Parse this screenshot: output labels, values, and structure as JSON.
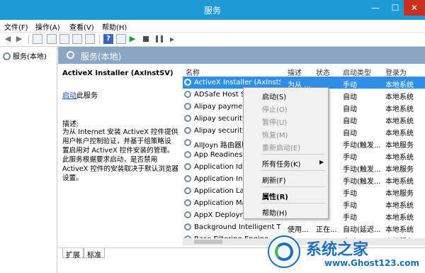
{
  "window": {
    "title": "服务",
    "min": "—",
    "max": "☐",
    "close": "✕"
  },
  "menu": [
    "文件(F)",
    "操作(A)",
    "查看(V)",
    "帮助(H)"
  ],
  "tree": {
    "root": "服务(本地)"
  },
  "pane": {
    "title": "服务(本地)"
  },
  "details": {
    "service_name": "ActiveX Installer (AxInstSV)",
    "start_link": "启动",
    "start_suffix": "此服务",
    "desc_label": "描述:",
    "desc_lines": [
      "为从 Internet 安装 ActiveX 控件提供",
      "用户帐户控制验证，并基于组策略设",
      "置启用对 ActiveX 控件安装的管理。",
      "此服务根据要求启动，是否禁用",
      "ActiveX 控件的安装取决于默认浏览器",
      "设置。"
    ]
  },
  "list": {
    "headers": {
      "name": "名称",
      "desc": "描述",
      "status": "状态",
      "type": "启动类型",
      "logon": "登录为"
    },
    "rows": [
      {
        "name": "ActiveX Installer (AxInstSV)",
        "desc": "为从 ...",
        "status": "",
        "type": "手动",
        "logon": "本地系统",
        "selected": true
      },
      {
        "name": "ADSafe Host Service",
        "desc": "",
        "status": "",
        "type": "自动",
        "logon": "本地系统"
      },
      {
        "name": "Alipay payment client",
        "desc": "",
        "status": "",
        "type": "自动",
        "logon": "本地系统"
      },
      {
        "name": "Alipay security business",
        "desc": "",
        "status": "",
        "type": "自动",
        "logon": "本地系统"
      },
      {
        "name": "Alipay security service",
        "desc": "",
        "status": "",
        "type": "自动",
        "logon": "本地系统"
      },
      {
        "name": "AllJoyn 路由器服务",
        "desc": "",
        "status": "",
        "type": "手动(触发...",
        "logon": "本地服务"
      },
      {
        "name": "App Readiness",
        "desc": "",
        "status": "",
        "type": "手动",
        "logon": "本地系统"
      },
      {
        "name": "Application Identity",
        "desc": "",
        "status": "",
        "type": "手动(触发...",
        "logon": "本地服务"
      },
      {
        "name": "Application Information",
        "desc": "",
        "status": "",
        "type": "手动(触发...",
        "logon": "本地系统"
      },
      {
        "name": "Application Layer Gateway",
        "desc": "",
        "status": "",
        "type": "手动",
        "logon": "本地服务"
      },
      {
        "name": "Application Management",
        "desc": "",
        "status": "",
        "type": "手动",
        "logon": "本地系统"
      },
      {
        "name": "AppX Deployment Service",
        "desc": "",
        "status": "",
        "type": "手动",
        "logon": "本地系统"
      },
      {
        "name": "Background Intelligent T...",
        "desc": "使用...",
        "status": "正在...",
        "type": "自动(延迟...",
        "logon": "本地系统"
      },
      {
        "name": "Base Filtering Engine",
        "desc": "",
        "status": "",
        "type": "自动",
        "logon": "本地服务"
      }
    ]
  },
  "tabs": [
    "扩展",
    "标准"
  ],
  "context_menu": {
    "start": "启动(S)",
    "stop": "停止(O)",
    "pause": "暂停(U)",
    "resume": "恢复(M)",
    "restart": "重新启动(E)",
    "all_tasks": "所有任务(K)",
    "refresh": "刷新(F)",
    "properties": "属性(R)",
    "help": "帮助(H)"
  },
  "watermark": {
    "text": "系统之家",
    "url": "www.Ghost123.com"
  },
  "icons": {
    "service": "gear-icon",
    "submenu": "chevron-right-icon"
  }
}
